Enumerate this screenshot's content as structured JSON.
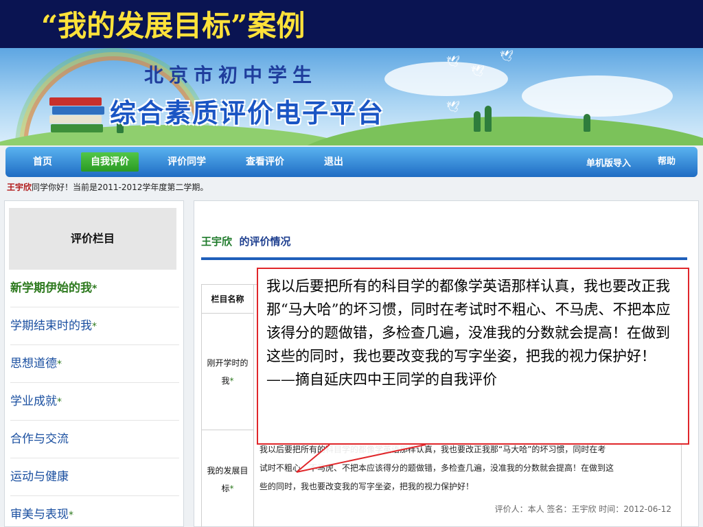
{
  "slide": {
    "title": "“我的发展目标”案例"
  },
  "banner": {
    "line1": "北京市初中学生",
    "line2": "综合素质评价电子平台"
  },
  "nav": {
    "items": [
      "首页",
      "自我评价",
      "评价同学",
      "查看评价",
      "退出"
    ],
    "active": "自我评价",
    "right_items": [
      "单机版导入",
      "帮助"
    ]
  },
  "greeting": {
    "name": "王宇欣",
    "text": "同学你好！当前是2011-2012学年度第二学期。"
  },
  "sidebar": {
    "header": "评价栏目",
    "items": [
      {
        "label": "新学期伊始的我",
        "star": "*"
      },
      {
        "label": "学期结束时的我",
        "star": "*"
      },
      {
        "label": "思想道德",
        "star": "*"
      },
      {
        "label": "学业成就",
        "star": "*"
      },
      {
        "label": "合作与交流",
        "star": ""
      },
      {
        "label": "运动与健康",
        "star": ""
      },
      {
        "label": "审美与表现",
        "star": "*"
      }
    ]
  },
  "main": {
    "student": "王宇欣",
    "title_suffix": "的评价情况",
    "table": {
      "column_header": "栏目名称",
      "rows": [
        {
          "name": "刚开学时的我",
          "star": "*"
        },
        {
          "name": "我的发展目标",
          "star": "*",
          "lines": [
            "我以后要把所有的科目学的都像学英语那样认真，我也要改正我那“马大哈”的坏习惯，同时在考",
            "试时不粗心、不马虎、不把本应该得分的题做错，多检查几遍，没准我的分数就会提高！在做到这",
            "些的同时，我也要改变我的写字坐姿，把我的视力保护好！"
          ],
          "footer": "评价人：本人   签名：王宇欣   时间：2012-06-12"
        }
      ]
    }
  },
  "callout": {
    "text": "我以后要把所有的科目学的都像学英语那样认真，我也要改正我那“马大哈”的坏习惯，同时在考试时不粗心、不马虎、不把本应该得分的题做错，多检查几遍，没准我的分数就会提高！在做到这些的同时，我也要改变我的写字坐姿，把我的视力保护好！——摘自延庆四中王同学的自我评价"
  },
  "colors": {
    "slide_background": "#0a1452",
    "slide_title": "#ffe23a",
    "nav_blue": "#1f6cc3",
    "nav_active": "#2a9a23",
    "callout_border": "#e0262a"
  }
}
